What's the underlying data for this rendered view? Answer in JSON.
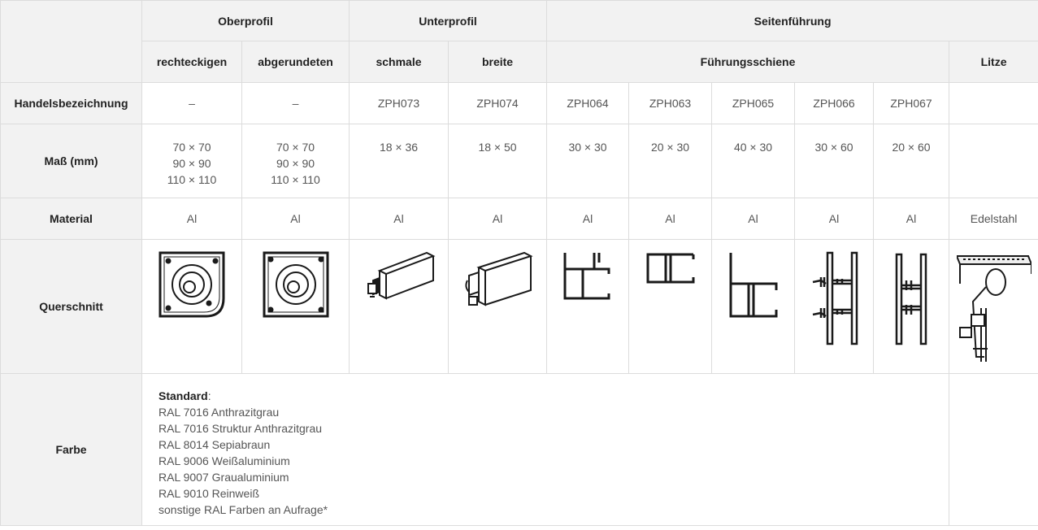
{
  "header": {
    "oberprofil": "Oberprofil",
    "unterprofil": "Unterprofil",
    "seitenfuehrung": "Seitenführung",
    "rechteckigen": "rechteckigen",
    "abgerundeten": "abgerundeten",
    "schmale": "schmale",
    "breite": "breite",
    "fuehrungsschiene": "Führungsschiene",
    "litze": "Litze"
  },
  "rows": {
    "handelsbezeichnung": {
      "label": "Handelsbezeichnung",
      "values": [
        "–",
        "–",
        "ZPH073",
        "ZPH074",
        "ZPH064",
        "ZPH063",
        "ZPH065",
        "ZPH066",
        "ZPH067",
        ""
      ]
    },
    "mass": {
      "label": "Maß (mm)",
      "rechteckig": [
        "70 × 70",
        "90 × 90",
        "110 × 110"
      ],
      "abgerundet": [
        "70 × 70",
        "90 × 90",
        "110 × 110"
      ],
      "values": [
        "18 × 36",
        "18 × 50",
        "30 × 30",
        "20 × 30",
        "40 × 30",
        "30 × 60",
        "20 × 60",
        ""
      ]
    },
    "material": {
      "label": "Material",
      "values": [
        "Al",
        "Al",
        "Al",
        "Al",
        "Al",
        "Al",
        "Al",
        "Al",
        "Al",
        "Edelstahl"
      ]
    },
    "querschnitt": {
      "label": "Querschnitt",
      "icons": [
        "rect-box-profile-icon",
        "rounded-box-profile-icon",
        "narrow-bottom-profile-icon",
        "wide-bottom-profile-icon",
        "rail-zph064-icon",
        "rail-zph063-icon",
        "rail-zph065-icon",
        "rail-zph066-icon",
        "rail-zph067-icon",
        "stainless-cable-icon"
      ]
    },
    "farbe": {
      "label": "Farbe",
      "standard_label": "Standard",
      "colon": ":",
      "colors": [
        "RAL 7016 Anthrazitgrau",
        "RAL 7016 Struktur Anthrazitgrau",
        "RAL 8014 Sepiabraun",
        "RAL 9006 Weißaluminium",
        "RAL 9007 Graualuminium",
        "RAL 9010 Reinweiß",
        "sonstige RAL Farben an Aufrage*"
      ]
    }
  },
  "colors": {
    "header_bg": "#f2f2f2",
    "border": "#dcdcdc",
    "drawing": "#1a1a1a"
  }
}
